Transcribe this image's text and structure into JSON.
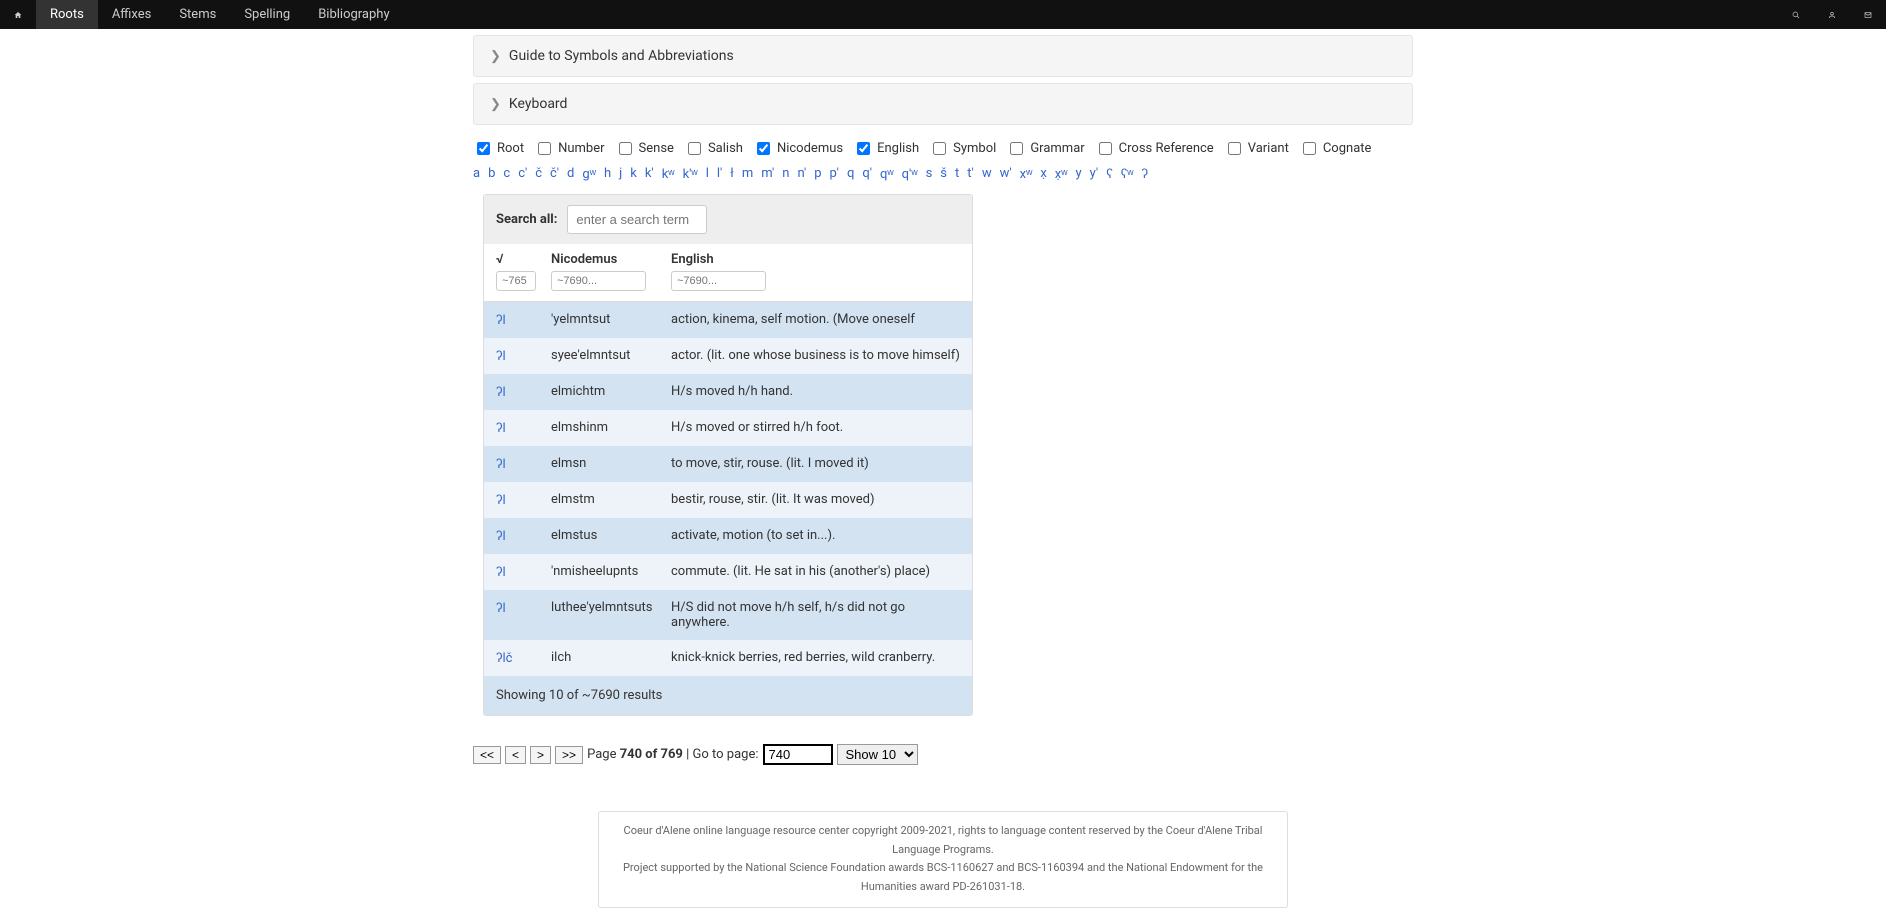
{
  "nav": {
    "items": [
      "Roots",
      "Affixes",
      "Stems",
      "Spelling",
      "Bibliography"
    ],
    "active": 0
  },
  "panels": {
    "guide": "Guide to Symbols and Abbreviations",
    "keyboard": "Keyboard"
  },
  "filters": [
    {
      "label": "Root",
      "checked": true
    },
    {
      "label": "Number",
      "checked": false
    },
    {
      "label": "Sense",
      "checked": false
    },
    {
      "label": "Salish",
      "checked": false
    },
    {
      "label": "Nicodemus",
      "checked": true
    },
    {
      "label": "English",
      "checked": true
    },
    {
      "label": "Symbol",
      "checked": false
    },
    {
      "label": "Grammar",
      "checked": false
    },
    {
      "label": "Cross Reference",
      "checked": false
    },
    {
      "label": "Variant",
      "checked": false
    },
    {
      "label": "Cognate",
      "checked": false
    }
  ],
  "letters": [
    "a",
    "b",
    "c",
    "c'",
    "č",
    "č'",
    "d",
    "gʷ",
    "h",
    "j",
    "k",
    "k'",
    "kʷ",
    "k'ʷ",
    "l",
    "l'",
    "ł",
    "m",
    "m'",
    "n",
    "n'",
    "p",
    "p'",
    "q",
    "q'",
    "qʷ",
    "q'ʷ",
    "s",
    "š",
    "t",
    "t'",
    "w",
    "w'",
    "xʷ",
    "x̣",
    "x̣ʷ",
    "y",
    "y'",
    "ʕ",
    "ʕʷ",
    "ʔ"
  ],
  "search": {
    "label": "Search all:",
    "placeholder": "enter a search term"
  },
  "columns": {
    "root": {
      "label": "√",
      "placeholder": "~765"
    },
    "nicodemus": {
      "label": "Nicodemus",
      "placeholder": "~7690..."
    },
    "english": {
      "label": "English",
      "placeholder": "~7690..."
    }
  },
  "rows": [
    {
      "root": "ʔl",
      "nic": "'yelmntsut",
      "eng": "action, kinema, self motion. (Move oneself"
    },
    {
      "root": "ʔl",
      "nic": "syee'elmntsut",
      "eng": "actor. (lit. one whose business is to move himself)"
    },
    {
      "root": "ʔl",
      "nic": "elmichtm",
      "eng": "H/s moved h/h hand."
    },
    {
      "root": "ʔl",
      "nic": "elmshinm",
      "eng": "H/s moved or stirred h/h foot."
    },
    {
      "root": "ʔl",
      "nic": "elmsn",
      "eng": "to move, stir, rouse. (lit. I moved it)"
    },
    {
      "root": "ʔl",
      "nic": "elmstm",
      "eng": "bestir, rouse, stir. (lit. It was moved)"
    },
    {
      "root": "ʔl",
      "nic": "elmstus",
      "eng": "activate, motion (to set in...)."
    },
    {
      "root": "ʔl",
      "nic": "'nmisheelupnts",
      "eng": "commute. (lit. He sat in his (another's) place)"
    },
    {
      "root": "ʔl",
      "nic": "luthee'yelmntsuts",
      "eng": "H/S did not move h/h self, h/s did not go anywhere."
    },
    {
      "root": "ʔlč",
      "nic": "ilch",
      "eng": "knick-knick berries, red berries, wild cranberry."
    }
  ],
  "resultmsg": "Showing 10 of ~7690 results",
  "pager": {
    "first": "<<",
    "prev": "<",
    "next": ">",
    "last": ">>",
    "page_label_pre": "Page ",
    "page_bold": "740 of 769",
    "goto_label": " | Go to page: ",
    "goto_value": "740",
    "select": "Show 10"
  },
  "footer": {
    "line1": "Coeur d'Alene online language resource center copyright 2009-2021, rights to language content reserved by the Coeur d'Alene Tribal Language Programs.",
    "line2": "Project supported by the National Science Foundation awards BCS-1160627 and BCS-1160394 and the National Endowment for the Humanities award PD-261031-18."
  }
}
